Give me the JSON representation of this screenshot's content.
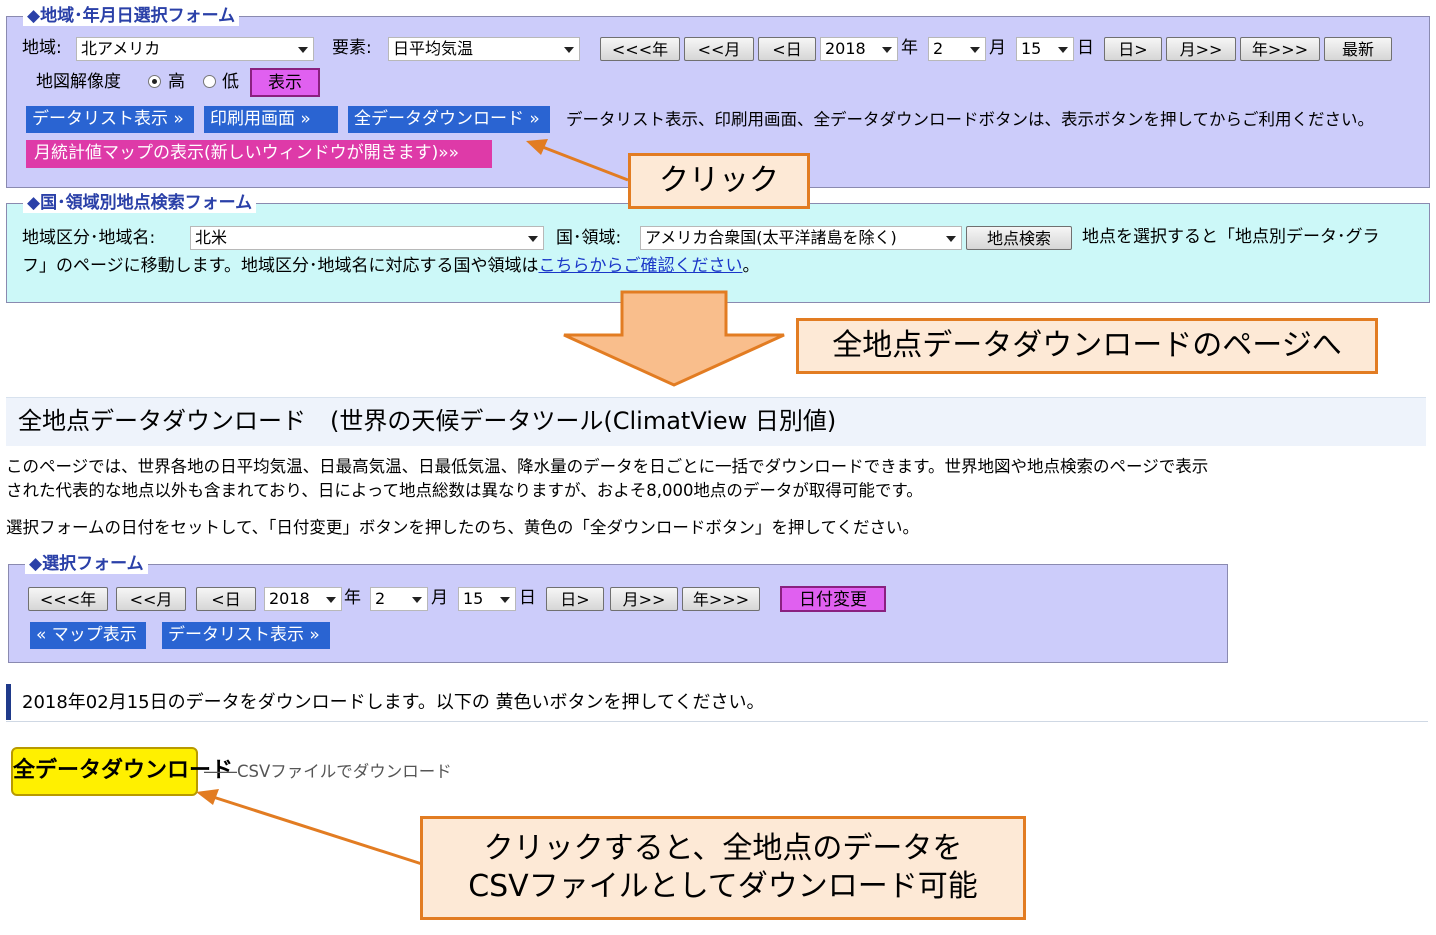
{
  "form1": {
    "legend": "◆地域･年月日選択フォーム",
    "region_label": "地域:",
    "region_value": "北アメリカ",
    "element_label": "要素:",
    "element_value": "日平均気温",
    "nav": {
      "prev_year": "<<<年",
      "prev_month": "<<月",
      "prev_day": "<日",
      "year_value": "2018",
      "year_unit": "年",
      "month_value": "2",
      "month_unit": "月",
      "day_value": "15",
      "day_unit": "日",
      "next_day": "日>",
      "next_month": "月>>",
      "next_year": "年>>>",
      "latest": "最新"
    },
    "resolution_label": "地図解像度",
    "res_high": "高",
    "res_low": "低",
    "show_button": "表示",
    "datalist_button": "データリスト表示 »",
    "print_button": "印刷用画面 »",
    "download_all_button": "全データダウンロード »",
    "note": "データリスト表示、印刷用画面、全データダウンロードボタンは、表示ボタンを押してからご利用ください。",
    "monthly_map_button": "月統計値マップの表示(新しいウィンドウが開きます)»»"
  },
  "form2": {
    "legend": "◆国･領域別地点検索フォーム",
    "area_label": "地域区分･地域名:",
    "area_value": "北米",
    "country_label": "国･領域:",
    "country_value": "アメリカ合衆国(太平洋諸島を除く)",
    "search_button": "地点検索",
    "desc_line1": "地点を選択すると「地点別データ･グラ",
    "desc_line2_prefix": "フ」のページに移動します。地域区分･地域名に対応する国や領域は",
    "desc_link": "こちらからご確認ください",
    "desc_suffix": "。"
  },
  "callouts": {
    "click": "クリック",
    "to_page": "全地点データダウンロードのページへ",
    "final_line1": "クリックすると、全地点のデータを",
    "final_line2": "CSVファイルとしてダウンロード可能"
  },
  "page2": {
    "title": "全地点データダウンロード　(世界の天候データツール(ClimatView 日別値)",
    "desc_line1": "このページでは、世界各地の日平均気温、日最高気温、日最低気温、降水量のデータを日ごとに一括でダウンロードできます。世界地図や地点検索のページで表示",
    "desc_line2": "された代表的な地点以外も含まれており、日によって地点総数は異なりますが、およそ8,000地点のデータが取得可能です。",
    "instruction": "選択フォームの日付をセットして、「日付変更」ボタンを押したのち、黄色の「全ダウンロードボタン」を押してください。",
    "form": {
      "legend": "◆選択フォーム",
      "prev_year": "<<<年",
      "prev_month": "<<月",
      "prev_day": "<日",
      "year_value": "2018",
      "year_unit": "年",
      "month_value": "2",
      "month_unit": "月",
      "day_value": "15",
      "day_unit": "日",
      "next_day": "日>",
      "next_month": "月>>",
      "next_year": "年>>>",
      "change_date": "日付変更",
      "map_button": "« マップ表示",
      "datalist_button": "データリスト表示 »"
    },
    "heading": "2018年02月15日のデータをダウンロードします。以下の 黄色いボタンを押してください。",
    "download_button": "全データダウンロード",
    "download_note": "――CSVファイルでダウンロード"
  },
  "colors": {
    "form_purple": "#ccccfa",
    "form_cyan": "#ccf8f8",
    "blue_button": "#2a64d2",
    "pink_button": "#de3aa8",
    "magenta_button": "#e060f0",
    "callout_fill": "#fde9d6",
    "callout_border": "#e27c22",
    "arrow_fill": "#f9be8c",
    "yellow_button": "#fff000"
  }
}
